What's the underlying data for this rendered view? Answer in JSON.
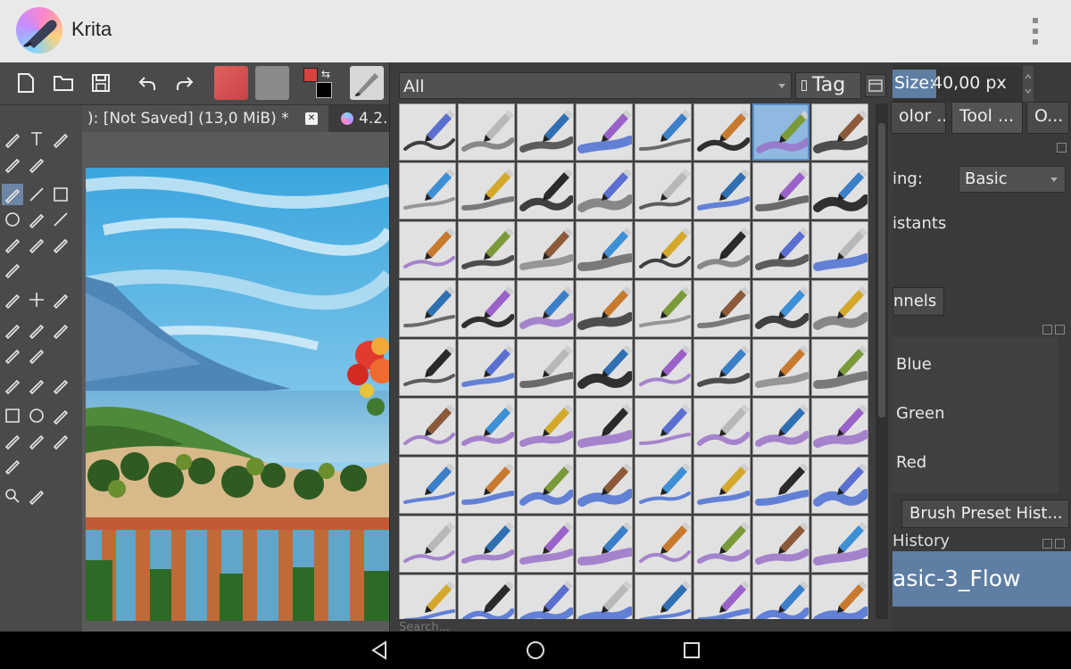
{
  "app": {
    "title": "Krita"
  },
  "colors": {
    "accent": "#5e7ea4",
    "fg_color": "#d9433e",
    "bg_color": "#000000",
    "selected_preset": "#8fb9e0"
  },
  "document": {
    "tab_label": "):  [Not Saved]  (13,0 MiB) *",
    "second_tab_label": "4.2."
  },
  "brush_editor": {
    "filter_value": "All",
    "tag_label": "Tag",
    "search_hint": "Search...",
    "rows": 9,
    "columns": 8,
    "selected_index": 6
  },
  "tool_options": {
    "size_label": "Size:",
    "size_value": "40,00 px",
    "tabs": [
      "olor ...",
      "Tool ...",
      "O..."
    ],
    "blending_label": "ing:",
    "blending_value": "Basic",
    "assistants_label": "istants"
  },
  "channels": {
    "tab_label": "nnels",
    "items": [
      "Blue",
      "Green",
      "Red"
    ]
  },
  "history": {
    "tab_label": "Brush Preset Hist...",
    "title": "History",
    "current_item": "asic-3_Flow"
  },
  "icons": {
    "new_document": "new-document-icon",
    "open": "folder-icon",
    "save": "save-icon",
    "undo": "undo-icon",
    "redo": "redo-icon"
  }
}
